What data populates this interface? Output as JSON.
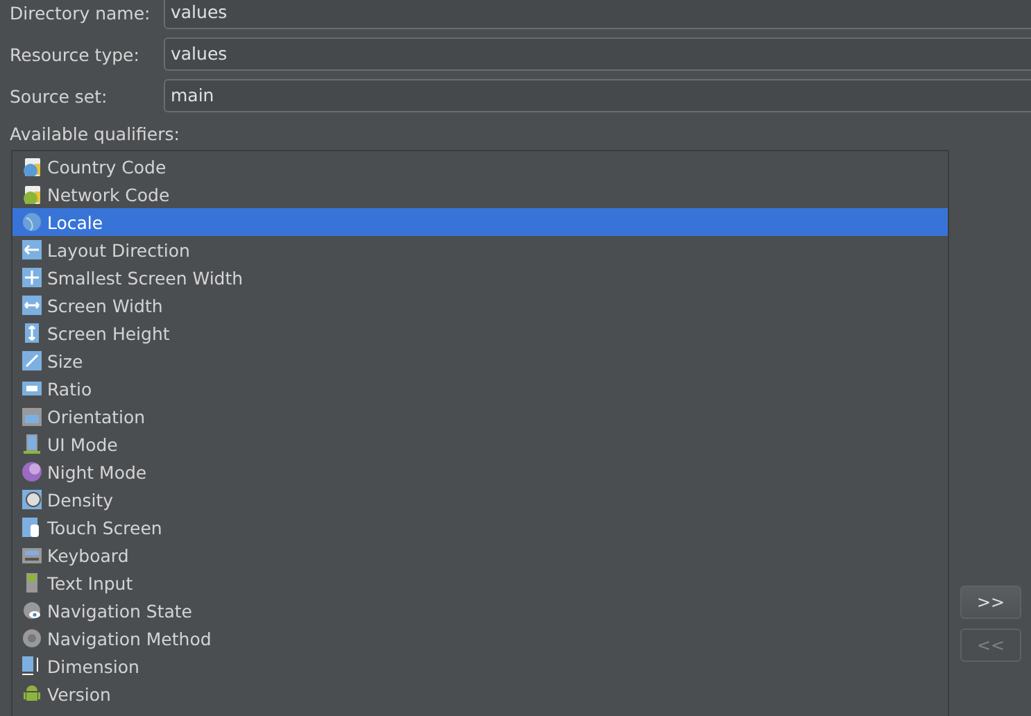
{
  "fields": [
    {
      "label": "Directory name:",
      "value": "values"
    },
    {
      "label": "Resource type:",
      "value": "values"
    },
    {
      "label": "Source set:",
      "value": "main"
    }
  ],
  "qualifiers_label": "Available qualifiers:",
  "qualifiers": [
    {
      "label": "Country Code",
      "selected": false
    },
    {
      "label": "Network Code",
      "selected": false
    },
    {
      "label": "Locale",
      "selected": true
    },
    {
      "label": "Layout Direction",
      "selected": false
    },
    {
      "label": "Smallest Screen Width",
      "selected": false
    },
    {
      "label": "Screen Width",
      "selected": false
    },
    {
      "label": "Screen Height",
      "selected": false
    },
    {
      "label": "Size",
      "selected": false
    },
    {
      "label": "Ratio",
      "selected": false
    },
    {
      "label": "Orientation",
      "selected": false
    },
    {
      "label": "UI Mode",
      "selected": false
    },
    {
      "label": "Night Mode",
      "selected": false
    },
    {
      "label": "Density",
      "selected": false
    },
    {
      "label": "Touch Screen",
      "selected": false
    },
    {
      "label": "Keyboard",
      "selected": false
    },
    {
      "label": "Text Input",
      "selected": false
    },
    {
      "label": "Navigation State",
      "selected": false
    },
    {
      "label": "Navigation Method",
      "selected": false
    },
    {
      "label": "Dimension",
      "selected": false
    },
    {
      "label": "Version",
      "selected": false
    }
  ],
  "buttons": [
    {
      "label": ">>",
      "disabled": false
    },
    {
      "label": "<<",
      "disabled": true
    }
  ]
}
